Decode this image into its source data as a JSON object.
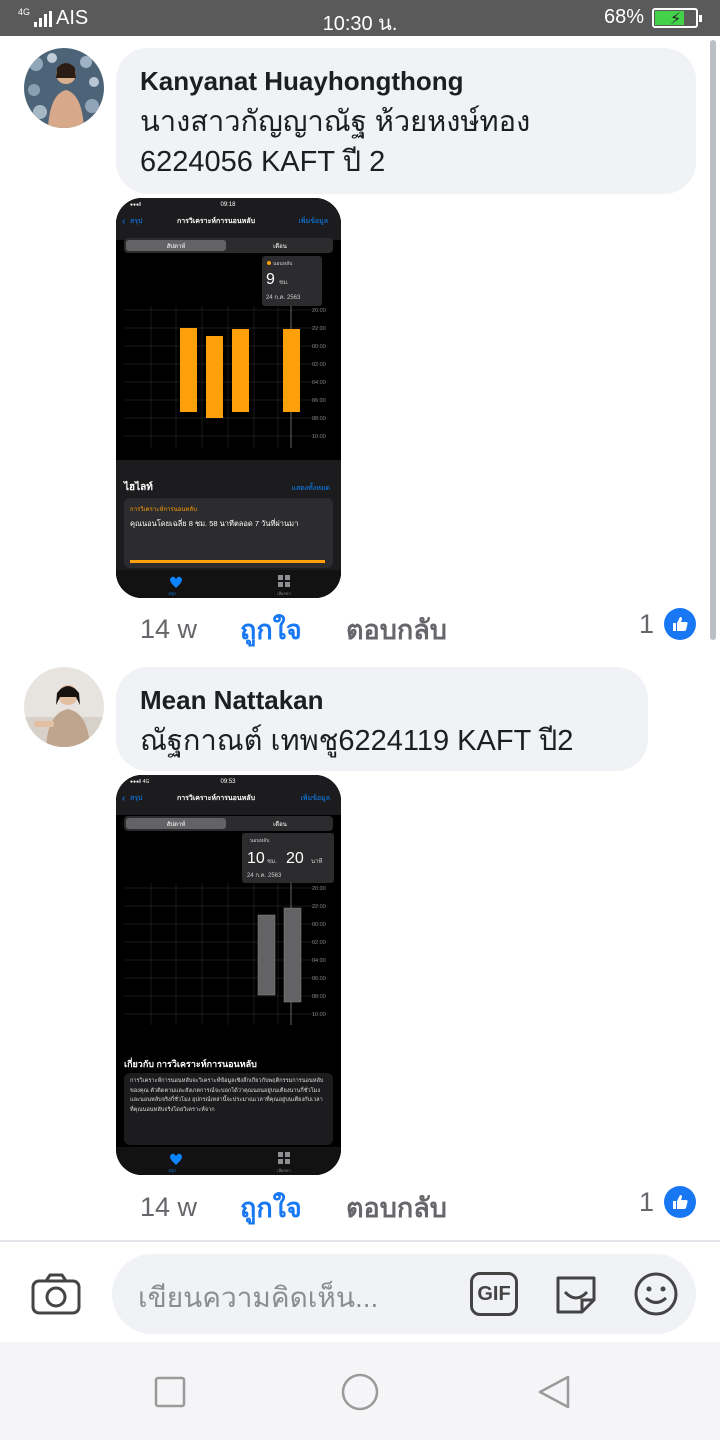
{
  "status_bar": {
    "network": "4G",
    "carrier": "AIS",
    "time": "10:30 น.",
    "battery": "68%"
  },
  "comments": [
    {
      "author": "Kanyanat Huayhongthong",
      "text_line1": "นางสาวกัญญาณัฐ ห้วยหงษ์ทอง",
      "text_line2": "6224056 KAFT ปี 2",
      "time": "14 w",
      "like_label": "ถูกใจ",
      "reply_label": "ตอบกลับ",
      "reaction_count": "1",
      "screenshot": {
        "status_time": "09:18",
        "back_label": "สรุป",
        "title": "การวิเคราะห์การนอนหลับ",
        "add_label": "เพิ่มข้อมูล",
        "seg_week": "สัปดาห์",
        "seg_month": "เดือน",
        "tooltip_label": "นอนหลับ",
        "tooltip_value": "9",
        "tooltip_unit": "ชม.",
        "tooltip_date": "24 ก.ค. 2563",
        "y_ticks": [
          "20:00",
          "22:00",
          "00:00",
          "02:00",
          "04:00",
          "06:00",
          "08:00",
          "10:00"
        ],
        "highlights_label": "ไฮไลท์",
        "show_all": "แสดงทั้งหมด",
        "card_title": "การวิเคราะห์การนอนหลับ",
        "card_text": "คุณนอนโดยเฉลี่ย 8 ชม. 58 นาทีตลอด 7 วันที่ผ่านมา",
        "tab_summary": "สรุป",
        "tab_browse": "เลือกหา"
      }
    },
    {
      "author": "Mean Nattakan",
      "text_line1": "ณัฐกาณต์ เทพชู6224119 KAFT ปี2",
      "time": "14 w",
      "like_label": "ถูกใจ",
      "reply_label": "ตอบกลับ",
      "reaction_count": "1",
      "screenshot": {
        "status_time": "09:53",
        "back_label": "สรุป",
        "title": "การวิเคราะห์การนอนหลับ",
        "add_label": "เพิ่มข้อมูล",
        "seg_week": "สัปดาห์",
        "seg_month": "เดือน",
        "tooltip_label": "นอนหลับ",
        "tooltip_value": "10",
        "tooltip_unit": "ชม.",
        "tooltip_value2": "20",
        "tooltip_unit2": "นาที",
        "tooltip_date": "24 ก.ค. 2563",
        "y_ticks": [
          "20:00",
          "22:00",
          "00:00",
          "02:00",
          "04:00",
          "06:00",
          "08:00",
          "10:00"
        ],
        "about_title": "เกี่ยวกับ การวิเคราะห์การนอนหลับ",
        "about_text": "การวิเคราะห์การนอนหลับจะวิเคราะห์ข้อมูลเชิงลึกเกี่ยวกับพฤติกรรมการนอนหลับของคุณ ตัวติดตามและสังเกตการณ์จะบอกได้ว่าคุณนอนอยู่บนเตียงนานกี่ชั่วโมง และนอนหลับจริงกี่ชั่วโมง อุปกรณ์เหล่านี้จะประมาณเวลาที่คุณอยู่บนเตียงกับเวลาที่คุณนอนหลับจริงโดยวิเคราะห์จาก",
        "tab_summary": "สรุป",
        "tab_browse": "เลือกหา"
      }
    }
  ],
  "composer": {
    "placeholder": "เขียนความคิดเห็น...",
    "gif_label": "GIF"
  },
  "colors": {
    "accent": "#1877f2",
    "bubble": "#f0f2f5",
    "sleep_bar": "#ff9f0a",
    "sleep_bar_gray": "#636366"
  }
}
